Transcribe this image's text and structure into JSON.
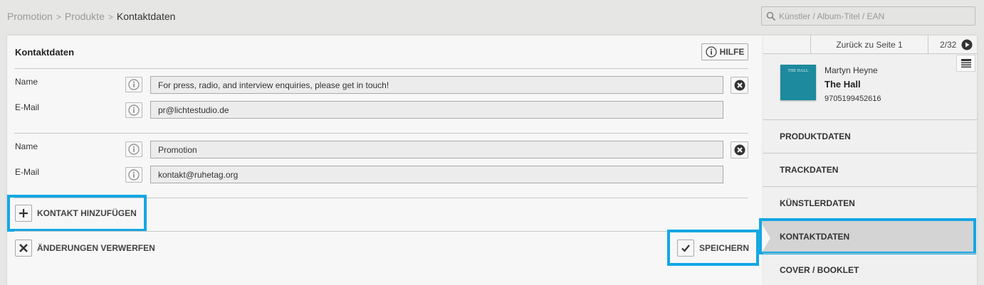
{
  "breadcrumb": {
    "items": [
      "Promotion",
      "Produkte",
      "Kontaktdaten"
    ],
    "separator": ">"
  },
  "search": {
    "placeholder": "Künstler / Album-Titel / EAN",
    "icon": "search-icon"
  },
  "panel": {
    "title": "Kontaktdaten",
    "help_label": "HILFE",
    "contacts": [
      {
        "name_label": "Name",
        "name_value": "For press, radio, and interview enquiries, please get in touch!",
        "email_label": "E-Mail",
        "email_value": "pr@lichtestudio.de"
      },
      {
        "name_label": "Name",
        "name_value": "Promotion",
        "email_label": "E-Mail",
        "email_value": "kontakt@ruhetag.org"
      }
    ],
    "add_contact_label": "KONTAKT HINZUFÜGEN",
    "discard_label": "ÄNDERUNGEN VERWERFEN",
    "save_label": "SPEICHERN"
  },
  "sidebar": {
    "back_label": "Zurück zu Seite 1",
    "page_count": "2/32",
    "product": {
      "artist": "Martyn Heyne",
      "album": "The Hall",
      "ean": "9705199452616",
      "cover_text": "THE HALL"
    },
    "nav": [
      {
        "label": "PRODUKTDATEN",
        "active": false
      },
      {
        "label": "TRACKDATEN",
        "active": false
      },
      {
        "label": "KÜNSTLERDATEN",
        "active": false
      },
      {
        "label": "KONTAKTDATEN",
        "active": true
      },
      {
        "label": "COVER / BOOKLET",
        "active": false
      }
    ]
  },
  "colors": {
    "highlight": "#14a7e3",
    "cover": "#1d8a9d"
  }
}
